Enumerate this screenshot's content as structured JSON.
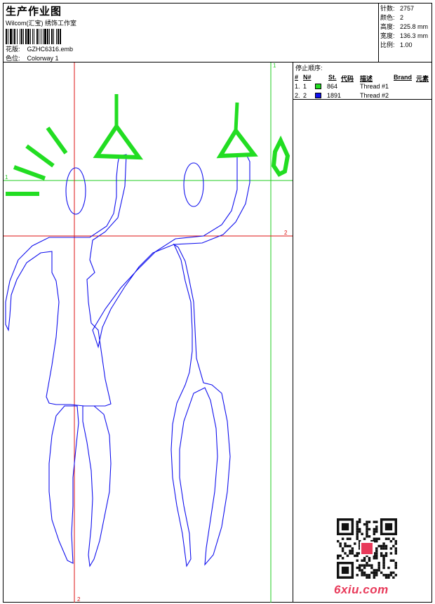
{
  "header": {
    "title": "生产作业图",
    "studio": "Wilcom(汇宝) 绣饰工作室",
    "design_label": "花版:",
    "design_value": "GZHC6316.emb",
    "colorway_label": "色位:",
    "colorway_value": "Colorway 1"
  },
  "stats": [
    {
      "label": "针数:",
      "value": "2757"
    },
    {
      "label": "颜色:",
      "value": "2"
    },
    {
      "label": "高度:",
      "value": "225.8 mm"
    },
    {
      "label": "宽度:",
      "value": "136.3 mm"
    },
    {
      "label": "比例:",
      "value": "1.00"
    }
  ],
  "stop_sequence": {
    "title": "停止顺序:",
    "columns": [
      "#",
      "N#",
      "St.",
      "代码",
      "描述",
      "Brand",
      "元素"
    ],
    "rows": [
      {
        "idx": "1.",
        "n": "1",
        "color": "#22dd22",
        "code": "864",
        "desc": "Thread #1"
      },
      {
        "idx": "2.",
        "n": "2",
        "color": "#1010ee",
        "code": "1891",
        "desc": "Thread #2"
      }
    ]
  },
  "guides": {
    "green_v_label": "1",
    "green_h_label": "1",
    "red_h_label": "2",
    "red_v_label": "2"
  },
  "watermark": {
    "site": "6xiu.com"
  },
  "colors": {
    "thread_green": "#22dd22",
    "thread_blue": "#1010ee",
    "guide_red": "#dd1111",
    "guide_green": "#22cc22"
  }
}
